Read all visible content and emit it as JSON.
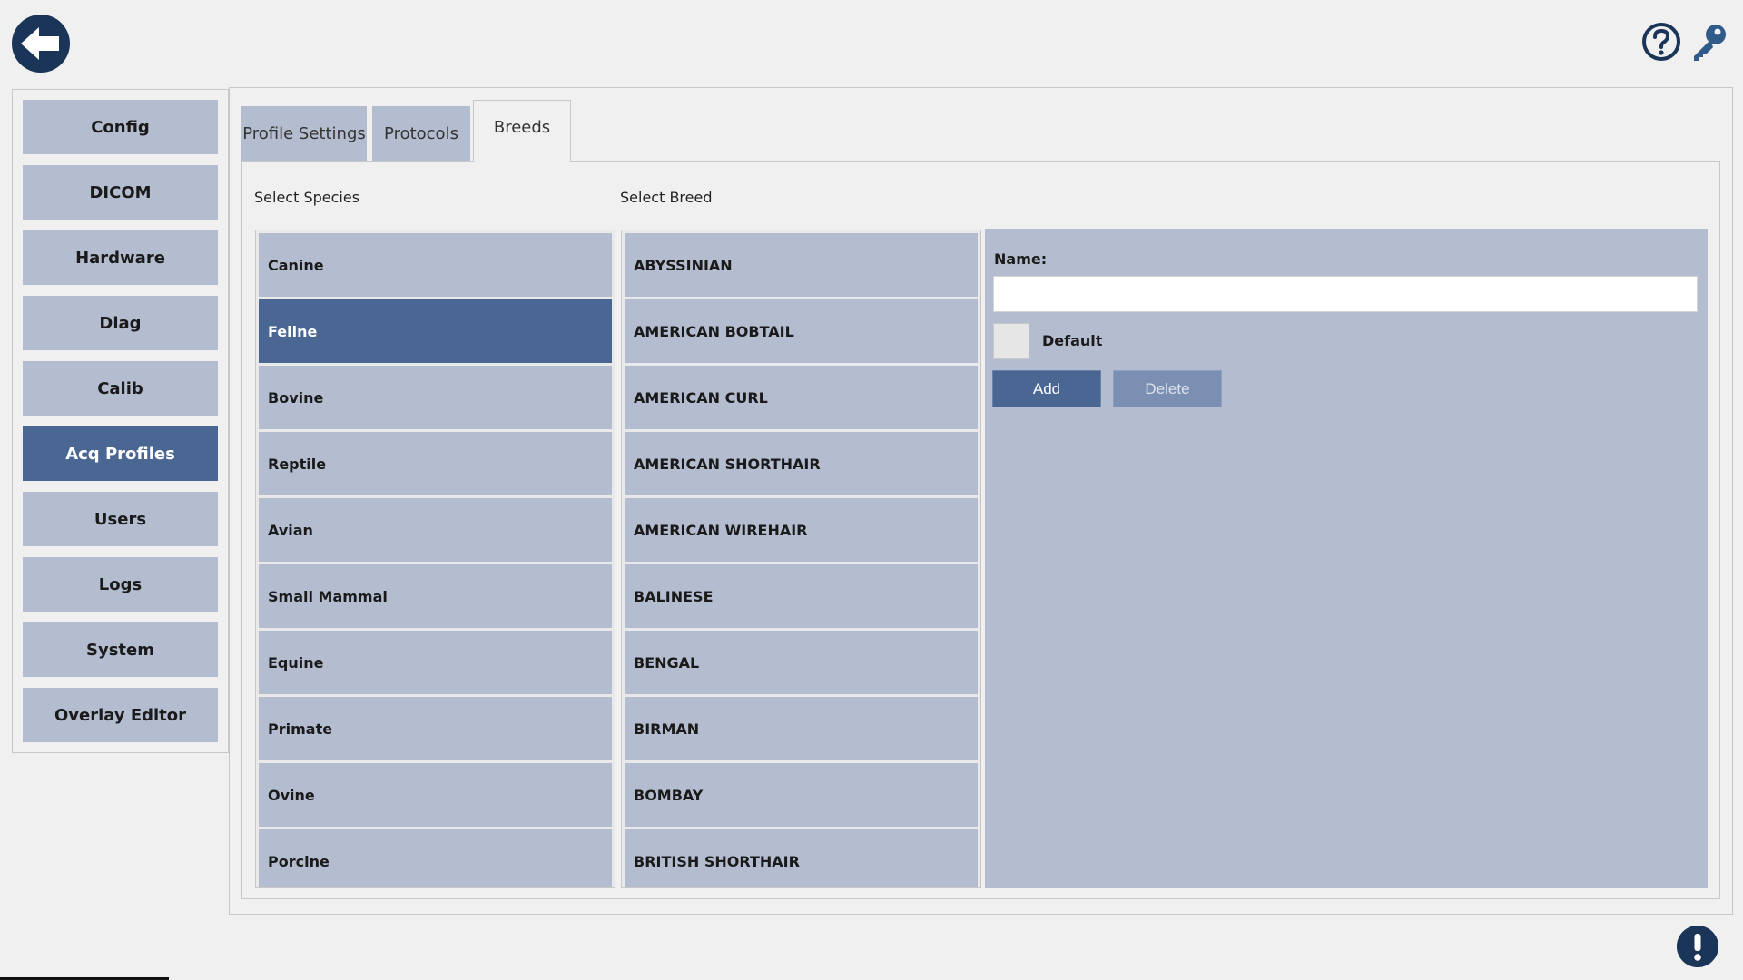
{
  "icons": {
    "back": "arrow-left-icon",
    "help": "question-circle-icon",
    "settings": "key-icon",
    "alert": "exclamation-icon"
  },
  "colors": {
    "accent": "#4a6794",
    "item": "#b4bcd0",
    "dark": "#1b3559"
  },
  "sidebar": {
    "items": [
      {
        "label": "Config"
      },
      {
        "label": "DICOM"
      },
      {
        "label": "Hardware"
      },
      {
        "label": "Diag"
      },
      {
        "label": "Calib"
      },
      {
        "label": "Acq Profiles",
        "active": true
      },
      {
        "label": "Users"
      },
      {
        "label": "Logs"
      },
      {
        "label": "System"
      },
      {
        "label": "Overlay Editor"
      }
    ]
  },
  "tabs": [
    {
      "label": "Profile Settings"
    },
    {
      "label": "Protocols"
    },
    {
      "label": "Breeds",
      "active": true
    }
  ],
  "species": {
    "label": "Select Species",
    "items": [
      "Canine",
      "Feline",
      "Bovine",
      "Reptile",
      "Avian",
      "Small Mammal",
      "Equine",
      "Primate",
      "Ovine",
      "Porcine"
    ],
    "selected": "Feline"
  },
  "breeds": {
    "label": "Select Breed",
    "items": [
      "ABYSSINIAN",
      "AMERICAN BOBTAIL",
      "AMERICAN CURL",
      "AMERICAN SHORTHAIR",
      "AMERICAN WIREHAIR",
      "BALINESE",
      "BENGAL",
      "BIRMAN",
      "BOMBAY",
      "BRITISH SHORTHAIR"
    ]
  },
  "editor": {
    "name_label": "Name:",
    "name_value": "",
    "default_label": "Default",
    "default_checked": false,
    "add_label": "Add",
    "delete_label": "Delete"
  }
}
